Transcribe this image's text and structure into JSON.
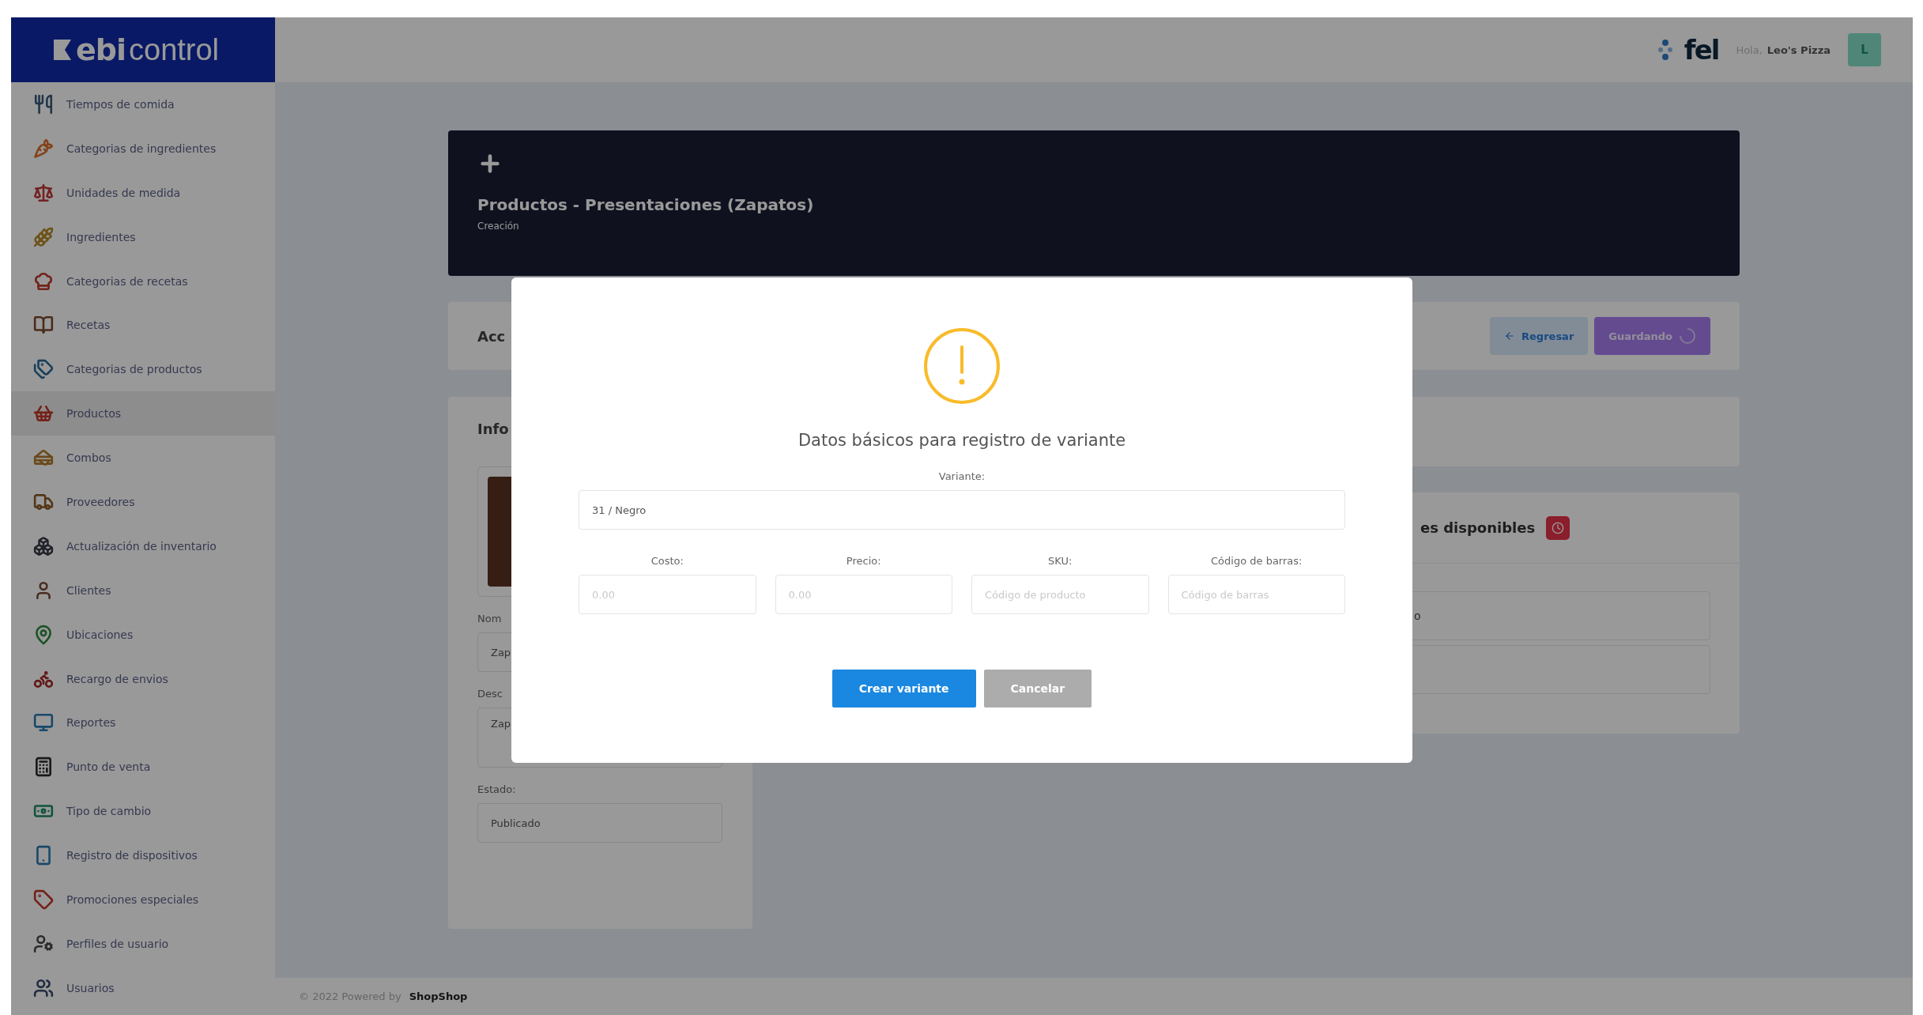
{
  "brand": {
    "bold": "ebi",
    "light": "control"
  },
  "header": {
    "partner_logo": "fel",
    "greeting": "Hola,",
    "user_name": "Leo's Pizza",
    "avatar_initial": "L"
  },
  "sidebar": {
    "items": [
      {
        "label": "Tiempos de comida",
        "selected": false
      },
      {
        "label": "Categorias de ingredientes",
        "selected": false
      },
      {
        "label": "Unidades de medida",
        "selected": false
      },
      {
        "label": "Ingredientes",
        "selected": false
      },
      {
        "label": "Categorias de recetas",
        "selected": false
      },
      {
        "label": "Recetas",
        "selected": false
      },
      {
        "label": "Categorias de productos",
        "selected": false
      },
      {
        "label": "Productos",
        "selected": true
      },
      {
        "label": "Combos",
        "selected": false
      },
      {
        "label": "Proveedores",
        "selected": false
      },
      {
        "label": "Actualización de inventario",
        "selected": false
      },
      {
        "label": "Clientes",
        "selected": false
      },
      {
        "label": "Ubicaciones",
        "selected": false
      },
      {
        "label": "Recargo de envios",
        "selected": false
      },
      {
        "label": "Reportes",
        "selected": false
      },
      {
        "label": "Punto de venta",
        "selected": false
      },
      {
        "label": "Tipo de cambio",
        "selected": false
      },
      {
        "label": "Registro de dispositivos",
        "selected": false
      },
      {
        "label": "Promociones especiales",
        "selected": false
      },
      {
        "label": "Perfiles de usuario",
        "selected": false
      },
      {
        "label": "Usuarios",
        "selected": false
      }
    ]
  },
  "page_header": {
    "title": "Productos - Presentaciones (Zapatos)",
    "subtitle": "Creación"
  },
  "actions_card": {
    "title": "Acc",
    "buttons": [
      {
        "label": "Regresar",
        "kind": "back"
      },
      {
        "label": "Guardando",
        "kind": "saving"
      }
    ]
  },
  "info_card": {
    "title": "Info",
    "fields": [
      {
        "label": "Nom",
        "value": "Zap",
        "kind": "input"
      },
      {
        "label": "Desc",
        "value": "Zap",
        "kind": "textarea"
      },
      {
        "label": "Estado:",
        "value": "Publicado",
        "kind": "input"
      }
    ]
  },
  "variants_card": {
    "title": "es disponibles",
    "row_text": "o"
  },
  "modal": {
    "title": "Datos básicos para registro de variante",
    "variant": {
      "label": "Variante:",
      "value": "31 / Negro"
    },
    "columns": [
      {
        "label": "Costo:",
        "placeholder": "0.00"
      },
      {
        "label": "Precio:",
        "placeholder": "0.00"
      },
      {
        "label": "SKU:",
        "placeholder": "Código de producto"
      },
      {
        "label": "Código de barras:",
        "placeholder": "Código de barras"
      }
    ],
    "buttons": [
      {
        "label": "Crear variante",
        "kind": "primary"
      },
      {
        "label": "Cancelar",
        "kind": "secondary"
      }
    ]
  },
  "footer": {
    "copyright": "© 2022 Powered by",
    "brand": "ShopShop"
  }
}
